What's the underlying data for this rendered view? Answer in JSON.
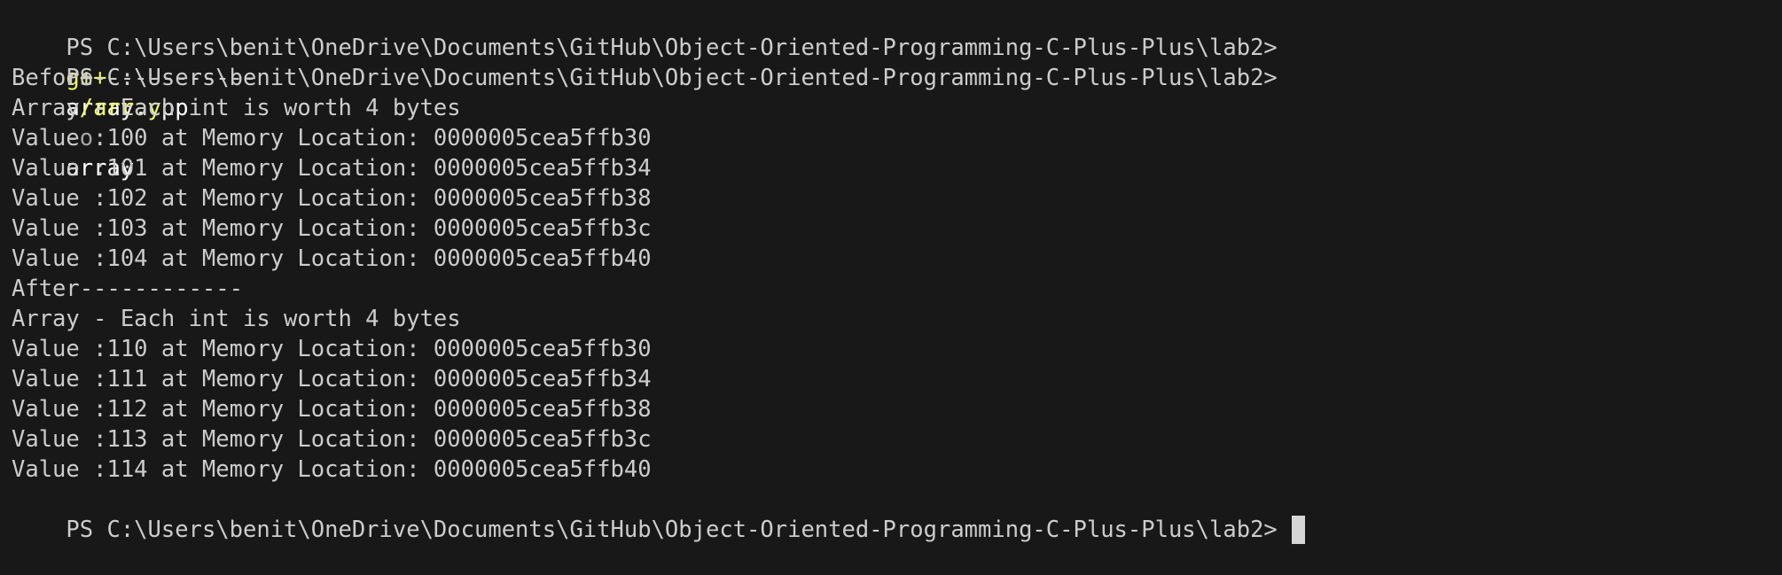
{
  "terminal": {
    "prompt": "PS C:\\Users\\benit\\OneDrive\\Documents\\GitHub\\Object-Oriented-Programming-C-Plus-Plus\\lab2>",
    "command1": {
      "name": "g++",
      "file": "array.cpp",
      "flag": "-o",
      "target": "array"
    },
    "command2": {
      "name": "./array"
    },
    "output": {
      "before_header": "Before------------",
      "after_header": "After------------",
      "array_info": "Array - Each int is worth 4 bytes",
      "before_values": [
        "Value :100 at Memory Location: 0000005cea5ffb30",
        "Value :101 at Memory Location: 0000005cea5ffb34",
        "Value :102 at Memory Location: 0000005cea5ffb38",
        "Value :103 at Memory Location: 0000005cea5ffb3c",
        "Value :104 at Memory Location: 0000005cea5ffb40"
      ],
      "after_values": [
        "Value :110 at Memory Location: 0000005cea5ffb30",
        "Value :111 at Memory Location: 0000005cea5ffb34",
        "Value :112 at Memory Location: 0000005cea5ffb38",
        "Value :113 at Memory Location: 0000005cea5ffb3c",
        "Value :114 at Memory Location: 0000005cea5ffb40"
      ]
    },
    "colors": {
      "background": "#181818",
      "text": "#cccccc",
      "command": "#f1fa64",
      "flag": "#a6a6a6",
      "cursor": "#d6d6d6"
    }
  }
}
